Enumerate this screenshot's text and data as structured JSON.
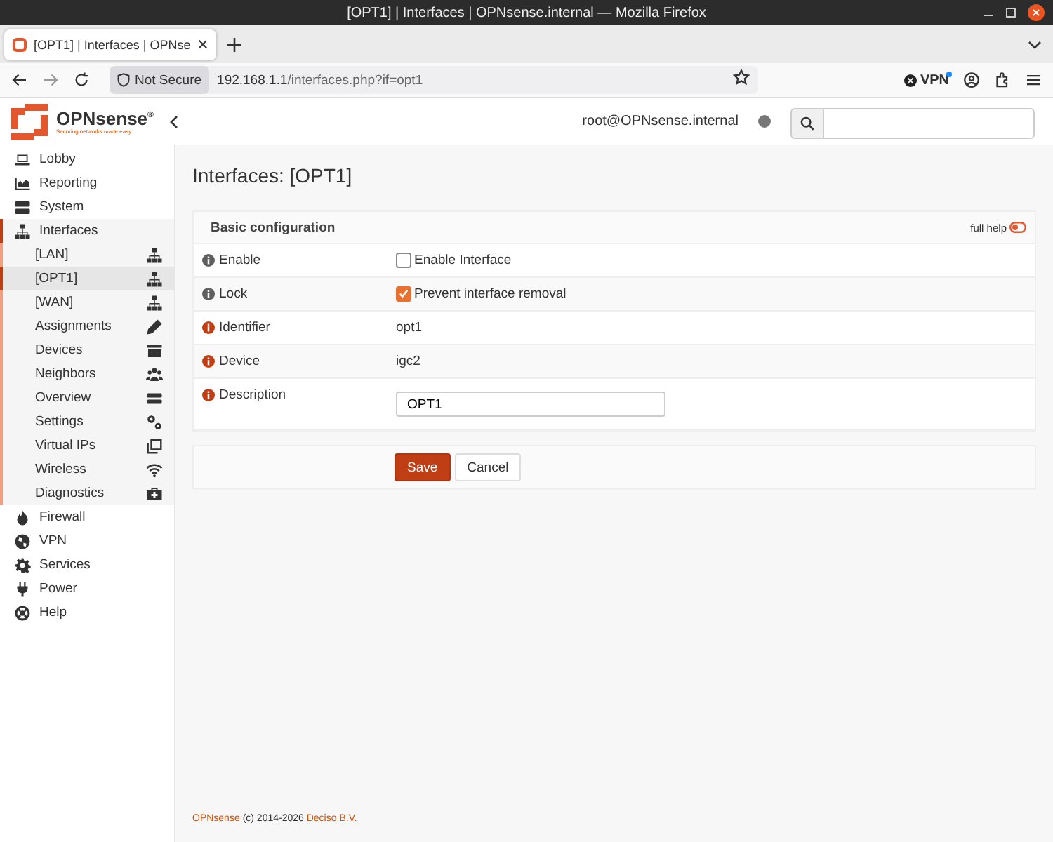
{
  "browser": {
    "window_title": "[OPT1] | Interfaces | OPNsense.internal — Mozilla Firefox",
    "tab_title": "[OPT1] | Interfaces | OPNse",
    "security_label": "Not Secure",
    "url_host": "192.168.1.1",
    "url_path": "/interfaces.php?if=opt1",
    "vpn_label": "VPN"
  },
  "header": {
    "logo_text": "OPNsense$^{®}$",
    "logo_tagline": "Securing networks made easy",
    "user": "root@OPNsense.internal"
  },
  "sidebar": {
    "items": [
      {
        "label": "Lobby",
        "expanded": false
      },
      {
        "label": "Reporting",
        "expanded": false
      },
      {
        "label": "System",
        "expanded": false
      },
      {
        "label": "Interfaces",
        "expanded": true,
        "children": [
          {
            "label": "[LAN]",
            "selected": false
          },
          {
            "label": "[OPT1]",
            "selected": true
          },
          {
            "label": "[WAN]",
            "selected": false
          },
          {
            "label": "Assignments",
            "selected": false
          },
          {
            "label": "Devices",
            "selected": false
          },
          {
            "label": "Neighbors",
            "selected": false
          },
          {
            "label": "Overview",
            "selected": false
          },
          {
            "label": "Settings",
            "selected": false
          },
          {
            "label": "Virtual IPs",
            "selected": false
          },
          {
            "label": "Wireless",
            "selected": false
          },
          {
            "label": "Diagnostics",
            "selected": false
          }
        ]
      },
      {
        "label": "Firewall",
        "expanded": false
      },
      {
        "label": "VPN",
        "expanded": false
      },
      {
        "label": "Services",
        "expanded": false
      },
      {
        "label": "Power",
        "expanded": false
      },
      {
        "label": "Help",
        "expanded": false
      }
    ]
  },
  "page": {
    "title": "Interfaces: [OPT1]",
    "panel_title": "Basic configuration",
    "full_help_label": "full help",
    "full_help_on": false,
    "rows": [
      {
        "kind": "checkbox",
        "label": "Enable",
        "color": "#5f5f5f",
        "text": "Enable Interface",
        "checked": false
      },
      {
        "kind": "checkbox",
        "label": "Lock",
        "color": "#5f5f5f",
        "text": "Prevent interface removal",
        "checked": true
      },
      {
        "kind": "text",
        "label": "Identifier",
        "color": "#c03e14",
        "value": "opt1"
      },
      {
        "kind": "text",
        "label": "Device",
        "color": "#c03e14",
        "value": "igc2"
      },
      {
        "kind": "input",
        "label": "Description",
        "color": "#c03e14",
        "value": "OPT1"
      }
    ],
    "buttons": [
      {
        "kind": "primary",
        "label": "Save"
      },
      {
        "kind": "default",
        "label": "Cancel"
      }
    ]
  },
  "footer": {
    "product": "OPNsense",
    "copyright": "(c) 2014-2026",
    "company": "Deciso B.V."
  }
}
